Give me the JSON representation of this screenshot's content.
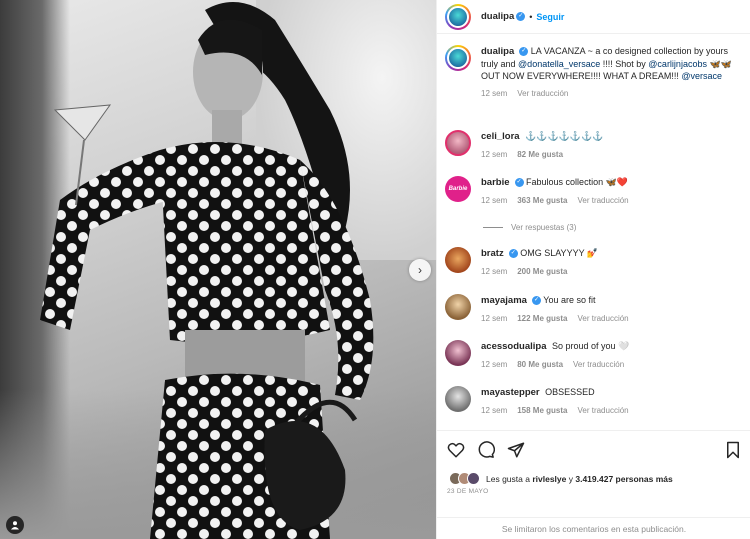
{
  "post": {
    "author": "dualipa",
    "follow_label": "Seguir",
    "separator": "•"
  },
  "caption": {
    "username": "dualipa",
    "text_1": "LA VACANZA ~ a co designed collection by yours truly and",
    "mention_1": "@donatella_versace",
    "text_2": "!!!! Shot by",
    "mention_2": "@carlijnjacobs",
    "text_3": "🦋🦋 OUT NOW EVERYWHERE!!!! WHAT A DREAM!!!",
    "mention_3": "@versace",
    "time": "12 sem",
    "translate": "Ver traducción"
  },
  "comments": [
    {
      "username": "celi_lora",
      "text": "⚓⚓⚓⚓⚓⚓⚓",
      "time": "12 sem",
      "likes": "82 Me gusta",
      "translate": ""
    },
    {
      "username": "barbie",
      "text": "Fabulous collection 🦋❤️",
      "time": "12 sem",
      "likes": "363 Me gusta",
      "translate": "Ver traducción"
    },
    {
      "username": "bratz",
      "text": "OMG SLAYYYY 💅",
      "time": "12 sem",
      "likes": "200 Me gusta",
      "translate": ""
    },
    {
      "username": "mayajama",
      "text": "You are so fit",
      "time": "12 sem",
      "likes": "122 Me gusta",
      "translate": "Ver traducción"
    },
    {
      "username": "acessodualipa",
      "text": "So proud of you 🤍",
      "time": "12 sem",
      "likes": "80 Me gusta",
      "translate": "Ver traducción"
    },
    {
      "username": "mayastepper",
      "text": "OBSESSED",
      "time": "12 sem",
      "likes": "158 Me gusta",
      "translate": "Ver traducción"
    }
  ],
  "replies_label": "Ver respuestas (3)",
  "barbie_avatar_text": "Barbie",
  "likes": {
    "prefix": "Les gusta a",
    "user": "rivleslye",
    "middle": "y",
    "count": "3.419.427 personas más"
  },
  "date": "23 DE MAYO",
  "comments_limited": "Se limitaron los comentarios en esta publicación.",
  "colors": {
    "link": "#0095f6",
    "verified": "#3897f0",
    "secondary_text": "#8e8e8e"
  },
  "icons": [
    "heart-icon",
    "comment-icon",
    "share-icon",
    "bookmark-icon",
    "chevron-right-icon",
    "user-tag-icon",
    "verified-icon"
  ]
}
